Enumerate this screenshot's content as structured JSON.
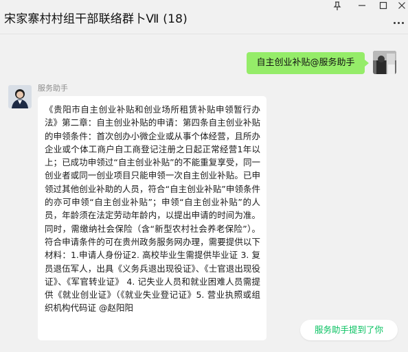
{
  "window": {
    "title": "宋家寨村村组干部联络群卜Ⅶ (18)"
  },
  "messages": [
    {
      "side": "right",
      "text": "自主创业补贴@服务助手"
    },
    {
      "side": "left",
      "sender": "服务助手",
      "text": "《贵阳市自主创业补贴和创业场所租赁补贴申领暂行办法》第二章：自主创业补贴的申请：第四条自主创业补贴的申领条件：首次创办小微企业或从事个体经营，且所办企业或个体工商户自工商登记注册之日起正常经营1年以上；已成功申领过“自主创业补贴”的不能重复享受，同一创业者或同一创业项目只能申领一次自主创业补贴。已申领过其他创业补助的人员，符合“自主创业补贴”申领条件的亦可申领“自主创业补贴”；申领“自主创业补贴”的人员，年龄须在法定劳动年龄内，以提出申请的时间为准。同时，需缴纳社会保险（含“新型农村社会养老保险”）。符合申请条件的可在贵州政务服务网办理，需要提供以下材料：1.申请人身份证2. 高校毕业生需提供毕业证 3. 复员退伍军人，出具《义务兵退出现役证》、《士官退出现役证》、《军官转业证》 4. 记失业人员和就业困难人员需提供《就业创业证》（《就业失业登记证》5. 营业执照或组织机构代码证 @赵阳阳"
    }
  ],
  "mention_notice": "服务助手提到了你",
  "icons": [
    "pin-icon",
    "minimize-icon",
    "maximize-icon",
    "close-icon",
    "more-icon"
  ]
}
